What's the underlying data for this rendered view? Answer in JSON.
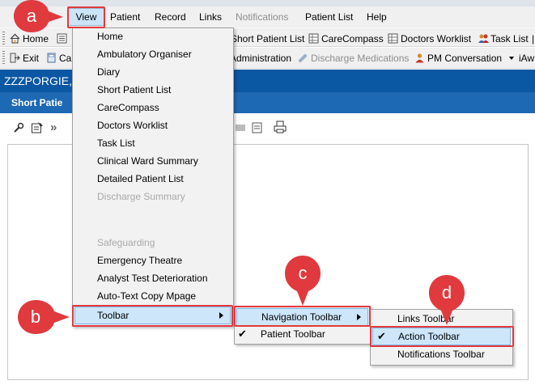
{
  "menubar": {
    "items": [
      {
        "label": "View"
      },
      {
        "label": "Patient"
      },
      {
        "label": "Record"
      },
      {
        "label": "Links"
      },
      {
        "label": "Notifications"
      },
      {
        "label": "Patient List"
      },
      {
        "label": "Help"
      }
    ]
  },
  "toolbar1": {
    "home": "Home",
    "short_patient_list": "Short Patient List",
    "carecompass": "CareCompass",
    "doctors_worklist": "Doctors Worklist",
    "task_list": "Task List"
  },
  "toolbar2": {
    "exit": "Exit",
    "partial_left": "Ca",
    "administration": "Administration",
    "discharge_medications": "Discharge Medications",
    "pm_conversation": "PM Conversation",
    "partial_right": "iAw"
  },
  "patient_bar": {
    "name": "ZZZPORGIE,"
  },
  "section_bar": {
    "title": "Short Patie"
  },
  "view_menu": {
    "items": [
      {
        "label": "Home",
        "enabled": true
      },
      {
        "label": "Ambulatory Organiser",
        "enabled": true
      },
      {
        "label": "Diary",
        "enabled": true
      },
      {
        "label": "Short Patient List",
        "enabled": true
      },
      {
        "label": "CareCompass",
        "enabled": true
      },
      {
        "label": "Doctors Worklist",
        "enabled": true
      },
      {
        "label": "Task List",
        "enabled": true
      },
      {
        "label": "Clinical Ward Summary",
        "enabled": true
      },
      {
        "label": "Detailed Patient List",
        "enabled": true
      },
      {
        "label": "Discharge Summary",
        "enabled": false
      },
      {
        "label": "Safeguarding",
        "enabled": false
      },
      {
        "label": "Emergency Theatre",
        "enabled": true
      },
      {
        "label": "Analyst Test Deterioration",
        "enabled": true
      },
      {
        "label": "Auto-Text Copy Mpage",
        "enabled": true
      }
    ],
    "toolbar": "Toolbar"
  },
  "toolbar_submenu": {
    "navigation_toolbar": "Navigation Toolbar",
    "patient_toolbar": "Patient Toolbar",
    "patient_toolbar_checked": true
  },
  "toolbar_submenu2": {
    "links_toolbar": "Links Toolbar",
    "action_toolbar": "Action Toolbar",
    "action_toolbar_checked": true,
    "notifications_toolbar": "Notifications Toolbar"
  },
  "callouts": {
    "a": "a",
    "b": "b",
    "c": "c",
    "d": "d"
  },
  "colors": {
    "callout": "#e03a3e",
    "highlight": "#cde6fa",
    "patient_bar": "#0a57a4",
    "section_bar": "#1e69b4"
  }
}
